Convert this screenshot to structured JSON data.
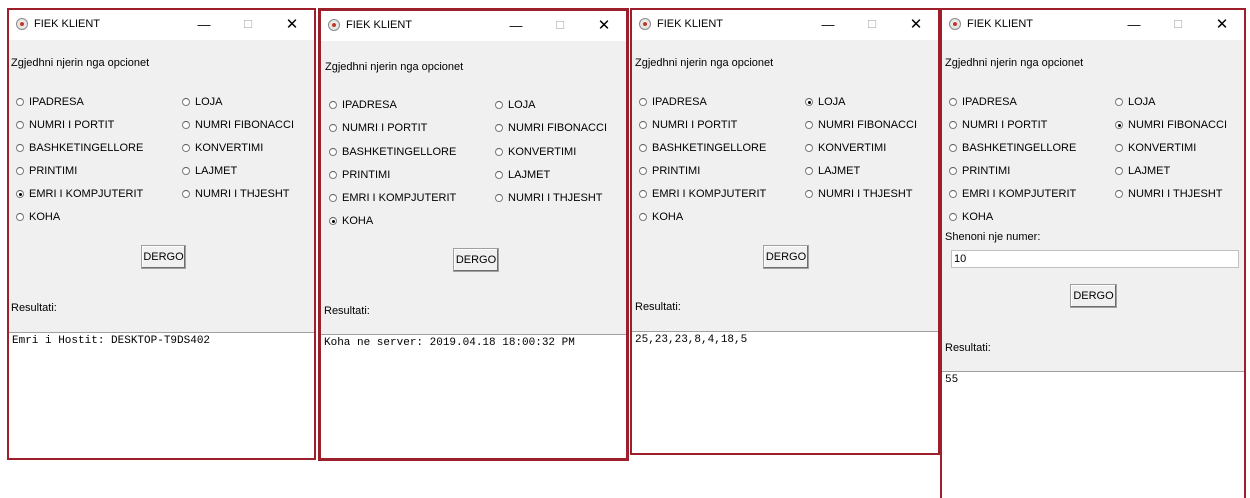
{
  "app_title": "FIEK KLIENT",
  "titlebar": {
    "minimize": "—",
    "maximize": "☐",
    "close": "✕"
  },
  "prompt": "Zgjedhni njerin nga opcionet",
  "options": {
    "ipadresa": "IPADRESA",
    "loja": "LOJA",
    "numri_portit": "NUMRI I PORTIT",
    "numri_fibonacci": "NUMRI FIBONACCI",
    "bashketingellore": "BASHKETINGELLORE",
    "konvertimi": "KONVERTIMI",
    "printimi": "PRINTIMI",
    "lajmet": "LAJMET",
    "emri_kompjuterit": "EMRI I KOMPJUTERIT",
    "numri_thjesht": "NUMRI I THJESHT",
    "koha": "KOHA"
  },
  "send_button": "DERGO",
  "result_label": "Resultati:",
  "windows": [
    {
      "selected": "emri_kompjuterit",
      "output": "Emri i Hostit: DESKTOP-T9DS402"
    },
    {
      "selected": "koha",
      "output": "Koha ne server: 2019.04.18 18:00:32 PM"
    },
    {
      "selected": "loja",
      "output": "25,23,23,8,4,18,5"
    },
    {
      "selected": "numri_fibonacci",
      "number_label": "Shenoni nje numer:",
      "number_value": "10",
      "output": "55"
    }
  ]
}
